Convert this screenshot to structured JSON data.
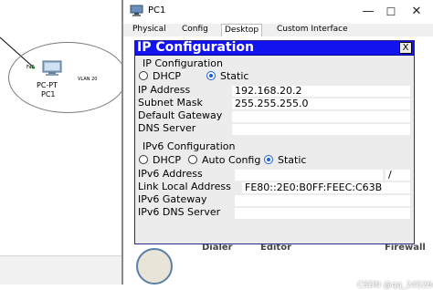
{
  "topology": {
    "port_label": "Fa0",
    "pc_type": "PC-PT",
    "pc_name": "PC1",
    "vlan_label": "VLAN 20"
  },
  "window": {
    "title": "PC1",
    "tabs": [
      {
        "label": "Physical"
      },
      {
        "label": "Config"
      },
      {
        "label": "Desktop",
        "active": true
      },
      {
        "label": "Custom Interface"
      }
    ],
    "controls": {
      "minimize": "—",
      "maximize": "☐",
      "close": "✕"
    }
  },
  "ip_config": {
    "title": "IP Configuration",
    "close_label": "X",
    "ipv4": {
      "section_title": "IP Configuration",
      "dhcp_label": "DHCP",
      "static_label": "Static",
      "selected": "Static",
      "fields": {
        "ip_address": {
          "label": "IP Address",
          "value": "192.168.20.2"
        },
        "subnet_mask": {
          "label": "Subnet Mask",
          "value": "255.255.255.0"
        },
        "default_gateway": {
          "label": "Default Gateway",
          "value": ""
        },
        "dns_server": {
          "label": "DNS Server",
          "value": ""
        }
      }
    },
    "ipv6": {
      "section_title": "IPv6 Configuration",
      "dhcp_label": "DHCP",
      "auto_label": "Auto Config",
      "static_label": "Static",
      "selected": "Static",
      "fields": {
        "ipv6_address": {
          "label": "IPv6 Address",
          "value": "/"
        },
        "link_local": {
          "label": "Link Local Address",
          "value": "FE80::2E0:B0FF:FEEC:C63B"
        },
        "ipv6_gateway": {
          "label": "IPv6 Gateway",
          "value": ""
        },
        "ipv6_dns": {
          "label": "IPv6 DNS Server",
          "value": ""
        }
      }
    }
  },
  "desktop_apps": {
    "dialer_partial": "Dialer",
    "editor_partial": "Editor",
    "firewall_partial": "Firewall"
  },
  "watermark": "CSDN @qq_24526483",
  "colors": {
    "header_blue": "#1313f0",
    "radio_selected": "#1a5fd6"
  }
}
